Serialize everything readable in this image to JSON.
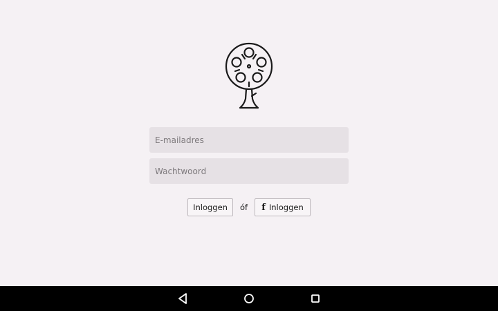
{
  "logo": {
    "icon": "film-reel-tree-icon"
  },
  "login_form": {
    "email_placeholder": "E-mailadres",
    "password_placeholder": "Wachtwoord",
    "login_button_label": "Inloggen",
    "or_text": "óf",
    "facebook_icon_glyph": "f",
    "facebook_button_label": "Inloggen"
  },
  "navbar": {
    "back_icon": "back-triangle-icon",
    "home_icon": "home-circle-icon",
    "recent_icon": "recent-apps-square-icon"
  },
  "colors": {
    "background": "#f5f1f4",
    "field_background": "#e6e1e5",
    "button_border": "#bdb8bc",
    "navbar": "#000000"
  }
}
